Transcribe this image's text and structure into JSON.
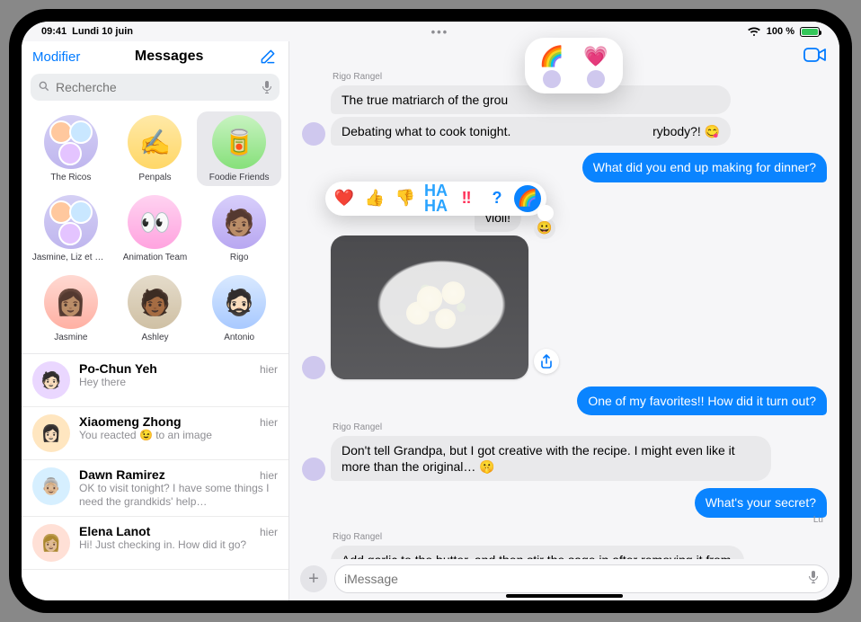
{
  "status": {
    "time": "09:41",
    "date": "Lundi 10 juin",
    "battery_text": "100 %"
  },
  "sidebar": {
    "edit_label": "Modifier",
    "title": "Messages",
    "search_placeholder": "Recherche",
    "pins": [
      {
        "label": "The Ricos",
        "style": "group"
      },
      {
        "label": "Penpals",
        "style": "yellow",
        "emoji": "✍️"
      },
      {
        "label": "Foodie Friends",
        "style": "green",
        "emoji": "🥫",
        "selected": true
      },
      {
        "label": "Jasmine, Liz et Rigo",
        "style": "group"
      },
      {
        "label": "Animation Team",
        "style": "pink",
        "emoji": "👀"
      },
      {
        "label": "Rigo",
        "style": "avatar"
      },
      {
        "label": "Jasmine",
        "style": "avatar"
      },
      {
        "label": "Ashley",
        "style": "avatar"
      },
      {
        "label": "Antonio",
        "style": "avatar"
      }
    ],
    "conversations": [
      {
        "name": "Po-Chun Yeh",
        "time": "hier",
        "preview": "Hey there"
      },
      {
        "name": "Xiaomeng Zhong",
        "time": "hier",
        "preview": "You reacted 😉 to an image"
      },
      {
        "name": "Dawn Ramirez",
        "time": "hier",
        "preview": "OK to visit tonight? I have some things I need the grandkids' help…"
      },
      {
        "name": "Elena Lanot",
        "time": "hier",
        "preview": "Hi! Just checking in. How did it go?"
      }
    ]
  },
  "chat": {
    "participant": "Rigo Rangel",
    "messages": {
      "m1": "The true matriarch of the grou",
      "m2_prefix": "Debating what to cook tonight.",
      "m2_suffix": "rybody?! 😋",
      "m3": "What did you end up making for dinner?",
      "m4": "violi!",
      "m5": "One of my favorites!! How did it turn out?",
      "m6": "Don't tell Grandpa, but I got creative with the recipe. I might even like it more than the original… 🤫",
      "m7": "What's your secret?",
      "m8": "Add garlic to the butter, and then stir the sage in after removing it from the heat, while it's still hot. Top with pine nuts!"
    },
    "read_label": "Lu",
    "compose_placeholder": "iMessage"
  },
  "tapback": {
    "options": [
      {
        "id": "heart",
        "glyph": "❤️"
      },
      {
        "id": "thumbs-up",
        "glyph": "👍"
      },
      {
        "id": "thumbs-down",
        "glyph": "👎"
      },
      {
        "id": "haha",
        "glyph": "HA HA"
      },
      {
        "id": "exclaim",
        "glyph": "‼"
      },
      {
        "id": "question",
        "glyph": "?"
      },
      {
        "id": "rainbow",
        "glyph": "🌈",
        "selected": true
      }
    ],
    "add_glyph": "😀"
  },
  "reactions": [
    {
      "emoji": "🌈"
    },
    {
      "emoji": "💗"
    }
  ]
}
